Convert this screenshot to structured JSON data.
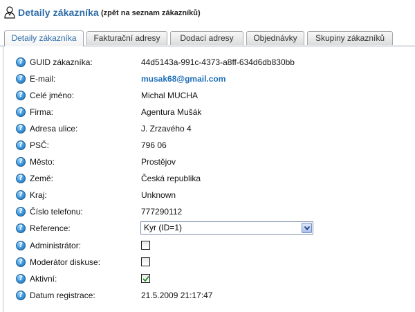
{
  "header": {
    "title": "Detaily zákazníka",
    "back_link": "(zpět na seznam zákazníků)"
  },
  "tabs": [
    {
      "label": "Detaily zákazníka",
      "active": true
    },
    {
      "label": "Fakturační adresy",
      "active": false
    },
    {
      "label": "Dodací adresy",
      "active": false
    },
    {
      "label": "Objednávky",
      "active": false
    },
    {
      "label": "Skupiny zákazníků",
      "active": false
    }
  ],
  "fields": {
    "guid": {
      "label": "GUID zákazníka:",
      "value": "44d5143a-991c-4373-a8ff-634d6db830bb"
    },
    "email": {
      "label": "E-mail:",
      "value": "musak68@gmail.com"
    },
    "full_name": {
      "label": "Celé jméno:",
      "value": "Michal MUCHA"
    },
    "company": {
      "label": "Firma:",
      "value": "Agentura Mušák"
    },
    "street": {
      "label": "Adresa ulice:",
      "value": "J. Zrzavého 4"
    },
    "zip": {
      "label": "PSČ:",
      "value": "796 06"
    },
    "city": {
      "label": "Město:",
      "value": "Prostějov"
    },
    "country": {
      "label": "Země:",
      "value": "Česká republika"
    },
    "region": {
      "label": "Kraj:",
      "value": "Unknown"
    },
    "phone": {
      "label": "Číslo telefonu:",
      "value": "777290112"
    },
    "reference": {
      "label": "Reference:",
      "value": "Kyr (ID=1)"
    },
    "admin": {
      "label": "Administrátor:",
      "checked": false
    },
    "moderator": {
      "label": "Moderátor diskuse:",
      "checked": false
    },
    "active": {
      "label": "Aktivní:",
      "checked": true
    },
    "registered": {
      "label": "Datum registrace:",
      "value": "21.5.2009 21:17:47"
    }
  },
  "colors": {
    "accent": "#2e6da8",
    "link": "#1f6fb8"
  },
  "icons": {
    "help": "question-mark",
    "user": "user-silhouette"
  }
}
